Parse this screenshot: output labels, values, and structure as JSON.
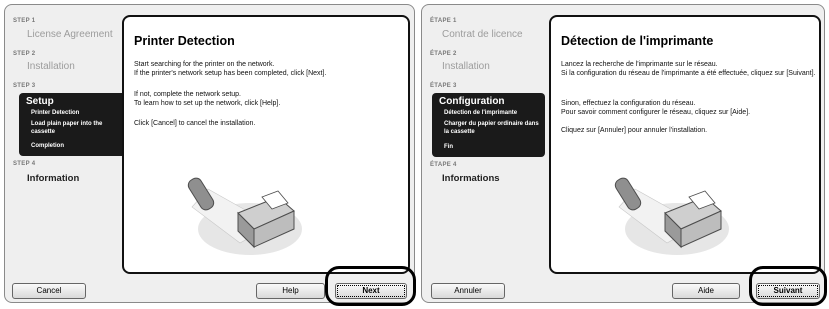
{
  "en": {
    "steps": {
      "step1_label": "STEP 1",
      "step1_title": "License Agreement",
      "step2_label": "STEP 2",
      "step2_title": "Installation",
      "step3_label": "STEP 3",
      "step3_title": "Setup",
      "step3_items": [
        "Printer Detection",
        "Load plain paper into the cassette",
        "Completion"
      ],
      "step4_label": "STEP 4",
      "step4_title": "Information"
    },
    "content": {
      "title": "Printer Detection",
      "para1": "Start searching for the printer on the network.\nIf the printer's network setup has been completed, click [Next].",
      "para2": "If not, complete the network setup.\nTo learn how to set up the network, click [Help].",
      "para3": "Click [Cancel] to cancel the installation."
    },
    "buttons": {
      "cancel": "Cancel",
      "help": "Help",
      "next": "Next"
    }
  },
  "fr": {
    "steps": {
      "step1_label": "ÉTAPE 1",
      "step1_title": "Contrat de licence",
      "step2_label": "ÉTAPE 2",
      "step2_title": "Installation",
      "step3_label": "ÉTAPE 3",
      "step3_title": "Configuration",
      "step3_items": [
        "Détection de l'imprimante",
        "Charger du papier ordinaire dans la cassette",
        "Fin"
      ],
      "step4_label": "ÉTAPE 4",
      "step4_title": "Informations"
    },
    "content": {
      "title": "Détection de l'imprimante",
      "para1": "Lancez la recherche de l'imprimante sur le réseau.\nSi la configuration du réseau de l'imprimante a été effectuée, cliquez sur [Suivant].",
      "para2": "Sinon, effectuez la configuration du réseau.\nPour savoir comment configurer le réseau, cliquez sur [Aide].",
      "para3": "Cliquez sur [Annuler] pour annuler l'installation."
    },
    "buttons": {
      "cancel": "Annuler",
      "help": "Aide",
      "next": "Suivant"
    }
  },
  "colors": {
    "highlight_block": "#1a1a1a",
    "panel_bg": "#efefef",
    "content_border": "#111111"
  }
}
